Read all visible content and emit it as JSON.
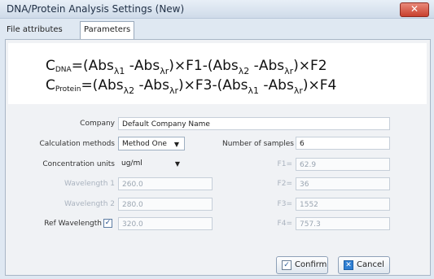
{
  "window": {
    "title": "DNA/Protein Analysis Settings (New)",
    "close_icon": "close-icon"
  },
  "tabs": [
    {
      "label": "File attributes"
    },
    {
      "label": "Parameters",
      "selected": true
    }
  ],
  "formula": {
    "line1": {
      "lhs_main": "C",
      "lhs_sub": "DNA",
      "p1": "=(Abs",
      "s1": "λ1",
      "p2": " -Abs",
      "s2": "λr",
      "p3": ")×F1-(Abs",
      "s3": "λ2",
      "p4": " -Abs",
      "s4": "λr",
      "p5": ")×F2"
    },
    "line2": {
      "lhs_main": "C",
      "lhs_sub": "Protein",
      "p1": "=(Abs",
      "s1": "λ2",
      "p2": " -Abs",
      "s2": "λr",
      "p3": ")×F3-(Abs",
      "s3": "λ1",
      "p4": " -Abs",
      "s4": "λr",
      "p5": ")×F4"
    }
  },
  "form": {
    "company_label": "Company",
    "company_value": "Default Company Name",
    "calc_label": "Calculation methods",
    "calc_value": "Method One",
    "samples_label": "Number of samples",
    "samples_value": "6",
    "conc_label": "Concentration units",
    "conc_value": "ug/ml",
    "wl1_label": "Wavelength 1",
    "wl1_value": "260.0",
    "wl2_label": "Wavelength 2",
    "wl2_value": "280.0",
    "ref_label": "Ref Wavelength",
    "ref_checked": "✓",
    "ref_value": "320.0",
    "f1_label": "F1=",
    "f1_value": "62.9",
    "f2_label": "F2=",
    "f2_value": "36",
    "f3_label": "F3=",
    "f3_value": "1552",
    "f4_label": "F4=",
    "f4_value": "757.3"
  },
  "buttons": {
    "confirm_label": "Confirm",
    "confirm_icon": "check-icon",
    "cancel_label": "Cancel",
    "cancel_icon": "cancel-icon"
  }
}
